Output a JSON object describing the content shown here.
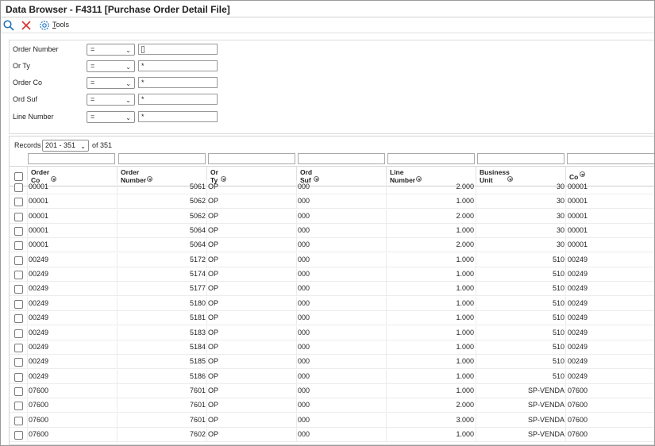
{
  "window": {
    "title": "Data Browser - F4311 [Purchase Order Detail File]"
  },
  "toolbar": {
    "find_icon": "search-icon",
    "close_icon": "close-icon",
    "tools_icon": "gear-icon",
    "tools_accel": "T",
    "tools_rest": "ools"
  },
  "qbe": [
    {
      "label": "Order Number",
      "op": "=",
      "value": ""
    },
    {
      "label": "Or Ty",
      "op": "=",
      "value": "*"
    },
    {
      "label": "Order Co",
      "op": "=",
      "value": "*"
    },
    {
      "label": "Ord Suf",
      "op": "=",
      "value": "*"
    },
    {
      "label": "Line Number",
      "op": "=",
      "value": "*"
    }
  ],
  "records": {
    "label": "Records",
    "range": "201 - 351",
    "of_text": "of 351"
  },
  "columns": [
    {
      "label": "Order\nCo"
    },
    {
      "label": "Order\nNumber"
    },
    {
      "label": "Or\nTy"
    },
    {
      "label": "Ord\nSuf"
    },
    {
      "label": "Line\nNumber"
    },
    {
      "label": "Business\nUnit"
    },
    {
      "label": "Co"
    }
  ],
  "rows": [
    [
      "00001",
      "5061",
      "OP",
      "000",
      "2.000",
      "30",
      "00001"
    ],
    [
      "00001",
      "5062",
      "OP",
      "000",
      "1.000",
      "30",
      "00001"
    ],
    [
      "00001",
      "5062",
      "OP",
      "000",
      "2.000",
      "30",
      "00001"
    ],
    [
      "00001",
      "5064",
      "OP",
      "000",
      "1.000",
      "30",
      "00001"
    ],
    [
      "00001",
      "5064",
      "OP",
      "000",
      "2.000",
      "30",
      "00001"
    ],
    [
      "00249",
      "5172",
      "OP",
      "000",
      "1.000",
      "510",
      "00249"
    ],
    [
      "00249",
      "5174",
      "OP",
      "000",
      "1.000",
      "510",
      "00249"
    ],
    [
      "00249",
      "5177",
      "OP",
      "000",
      "1.000",
      "510",
      "00249"
    ],
    [
      "00249",
      "5180",
      "OP",
      "000",
      "1.000",
      "510",
      "00249"
    ],
    [
      "00249",
      "5181",
      "OP",
      "000",
      "1.000",
      "510",
      "00249"
    ],
    [
      "00249",
      "5183",
      "OP",
      "000",
      "1.000",
      "510",
      "00249"
    ],
    [
      "00249",
      "5184",
      "OP",
      "000",
      "1.000",
      "510",
      "00249"
    ],
    [
      "00249",
      "5185",
      "OP",
      "000",
      "1.000",
      "510",
      "00249"
    ],
    [
      "00249",
      "5186",
      "OP",
      "000",
      "1.000",
      "510",
      "00249"
    ],
    [
      "07600",
      "7601",
      "OP",
      "000",
      "1.000",
      "SP-VENDA",
      "07600"
    ],
    [
      "07600",
      "7601",
      "OP",
      "000",
      "2.000",
      "SP-VENDA",
      "07600"
    ],
    [
      "07600",
      "7601",
      "OP",
      "000",
      "3.000",
      "SP-VENDA",
      "07600"
    ],
    [
      "07600",
      "7602",
      "OP",
      "000",
      "1.000",
      "SP-VENDA",
      "07600"
    ]
  ],
  "colors": {
    "close_red": "#d9302c",
    "find_blue": "#1f6fb5",
    "tools_blue": "#2a7dc9"
  }
}
